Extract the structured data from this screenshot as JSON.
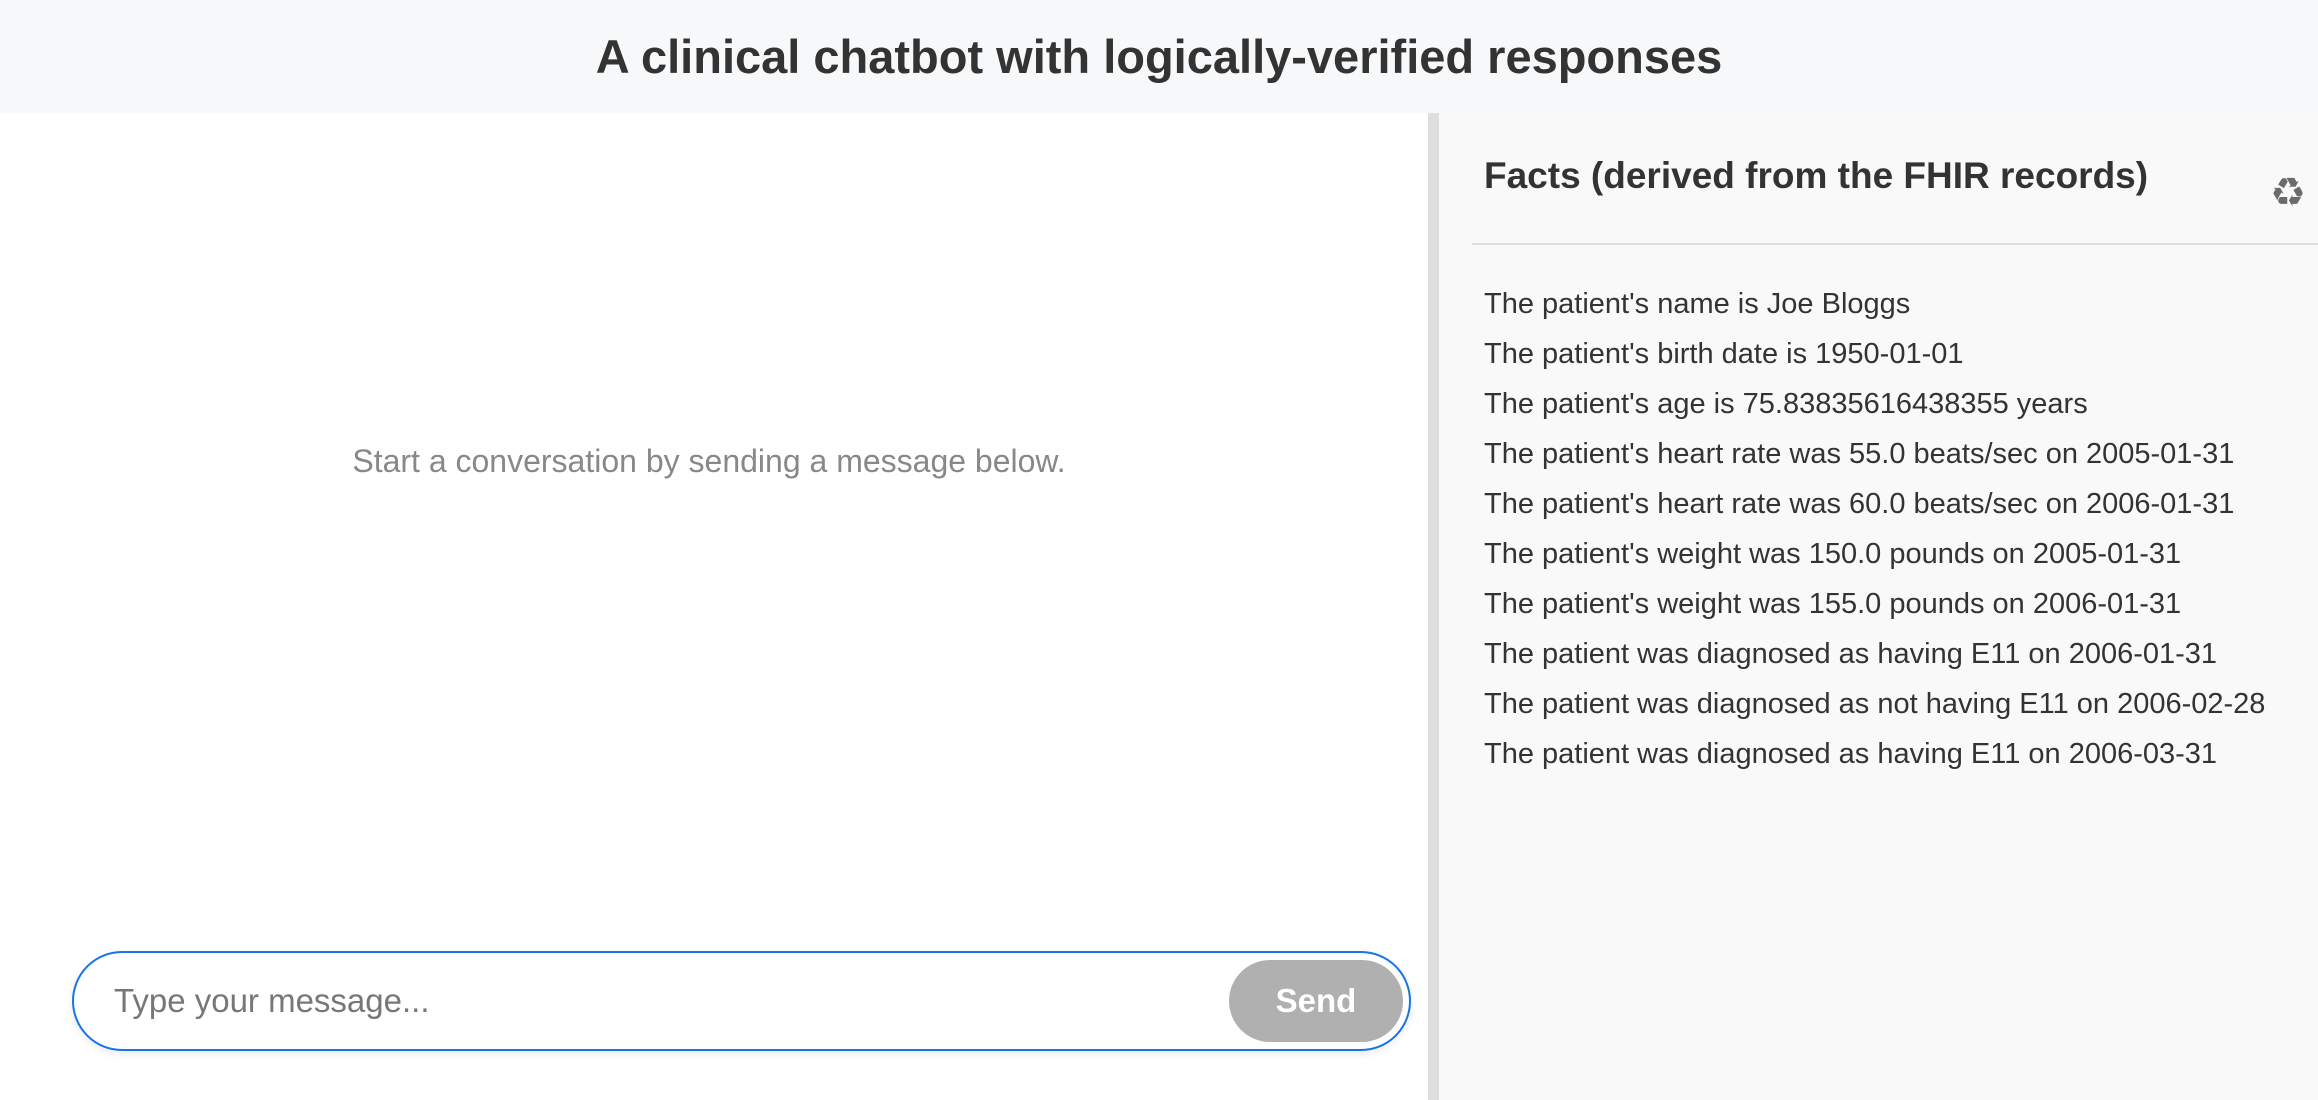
{
  "header": {
    "title": "A clinical chatbot with logically-verified responses"
  },
  "chat": {
    "empty_message": "Start a conversation by sending a message below.",
    "input_placeholder": "Type your message...",
    "input_value": "",
    "send_label": "Send"
  },
  "facts": {
    "title": "Facts (derived from the FHIR records)",
    "refresh_icon": "recycle-icon",
    "items": [
      "The patient's name is Joe Bloggs",
      "The patient's birth date is 1950-01-01",
      "The patient's age is 75.83835616438355 years",
      "The patient's heart rate was 55.0 beats/sec on 2005-01-31",
      "The patient's heart rate was 60.0 beats/sec on 2006-01-31",
      "The patient's weight was 150.0 pounds on 2005-01-31",
      "The patient's weight was 155.0 pounds on 2006-01-31",
      "The patient was diagnosed as having E11 on 2006-01-31",
      "The patient was diagnosed as not having E11 on 2006-02-28",
      "The patient was diagnosed as having E11 on 2006-03-31"
    ]
  },
  "colors": {
    "accent": "#1a73e8",
    "send_button_disabled": "#b0b0b0",
    "header_bg": "#f7f8fa",
    "facts_bg": "#f9f9f9"
  }
}
